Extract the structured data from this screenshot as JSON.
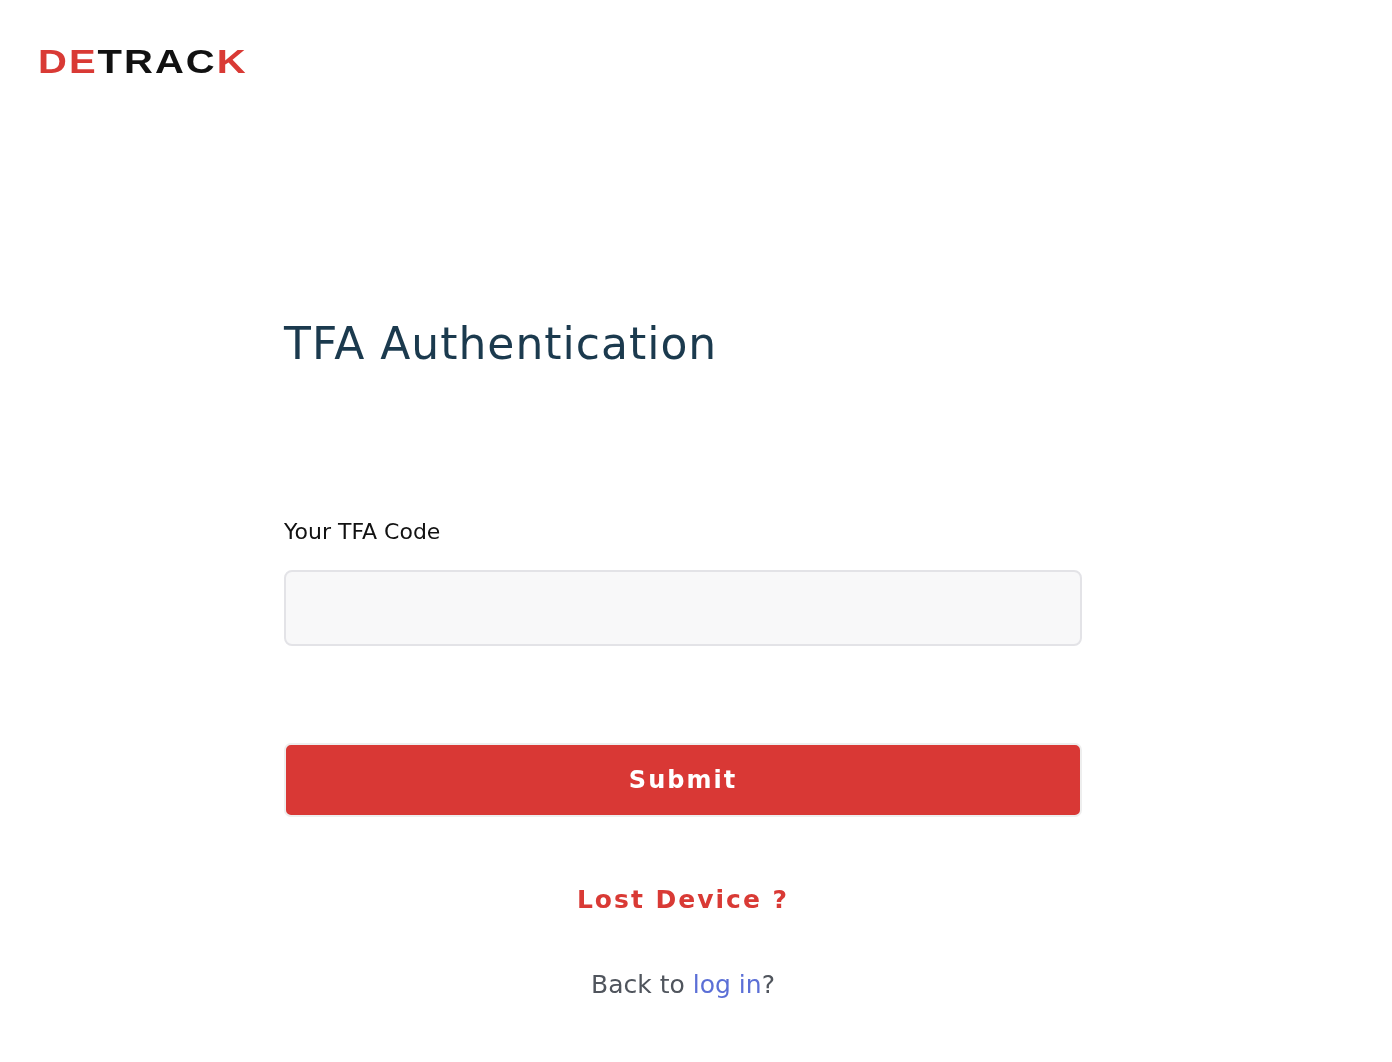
{
  "logo": {
    "parts": [
      {
        "text": "DE",
        "color": "#d93a35"
      },
      {
        "text": "TRAC",
        "color": "#111111"
      },
      {
        "text": "K",
        "color": "#d93a35"
      }
    ]
  },
  "title": "TFA Authentication",
  "code_field": {
    "label": "Your TFA Code"
  },
  "submit_button": "Submit",
  "lost_device_link": "Lost Device ?",
  "back": {
    "before": "Back to ",
    "link": "log in",
    "after": "?"
  }
}
